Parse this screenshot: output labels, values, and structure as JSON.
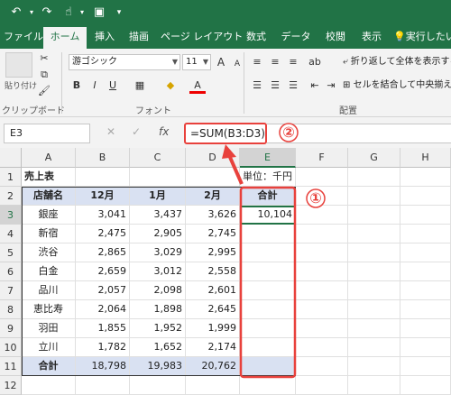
{
  "titlebar": {
    "icons": [
      "undo-icon",
      "redo-icon",
      "touch-mode-icon",
      "save-icon",
      "customize-dropdown-icon"
    ]
  },
  "tabs": [
    "ファイル",
    "ホーム",
    "挿入",
    "描画",
    "ページ レイアウト",
    "数式",
    "データ",
    "校閲",
    "表示",
    "実行したい"
  ],
  "ribbon": {
    "paste_label": "貼り付け",
    "clipboard_label": "クリップボード",
    "font_name": "游ゴシック",
    "font_size": "11",
    "font_label": "フォント",
    "wrap_text": "折り返して全体を表示する",
    "merge_center": "セルを結合して中央揃え",
    "alignment_label": "配置"
  },
  "formula_bar": {
    "name_box": "E3",
    "fx": "fx",
    "formula": "=SUM(B3:D3)"
  },
  "columns": [
    "A",
    "B",
    "C",
    "D",
    "E",
    "F",
    "G",
    "H"
  ],
  "rows": [
    "1",
    "2",
    "3",
    "4",
    "5",
    "6",
    "7",
    "8",
    "9",
    "10",
    "11",
    "12"
  ],
  "sheet": {
    "title": "売上表",
    "unit": "単位：千円",
    "headers": [
      "店舗名",
      "12月",
      "1月",
      "2月",
      "合計"
    ],
    "data": [
      [
        "銀座",
        "3,041",
        "3,437",
        "3,626",
        "10,104"
      ],
      [
        "新宿",
        "2,475",
        "2,905",
        "2,745",
        ""
      ],
      [
        "渋谷",
        "2,865",
        "3,029",
        "2,995",
        ""
      ],
      [
        "白金",
        "2,659",
        "3,012",
        "2,558",
        ""
      ],
      [
        "品川",
        "2,057",
        "2,098",
        "2,601",
        ""
      ],
      [
        "恵比寿",
        "2,064",
        "1,898",
        "2,645",
        ""
      ],
      [
        "羽田",
        "1,855",
        "1,952",
        "1,999",
        ""
      ],
      [
        "立川",
        "1,782",
        "1,652",
        "2,174",
        ""
      ]
    ],
    "total": [
      "合計",
      "18,798",
      "19,983",
      "20,762",
      ""
    ]
  },
  "annotations": {
    "badge1": "①",
    "badge2": "②",
    "accent": "#e8413c"
  }
}
